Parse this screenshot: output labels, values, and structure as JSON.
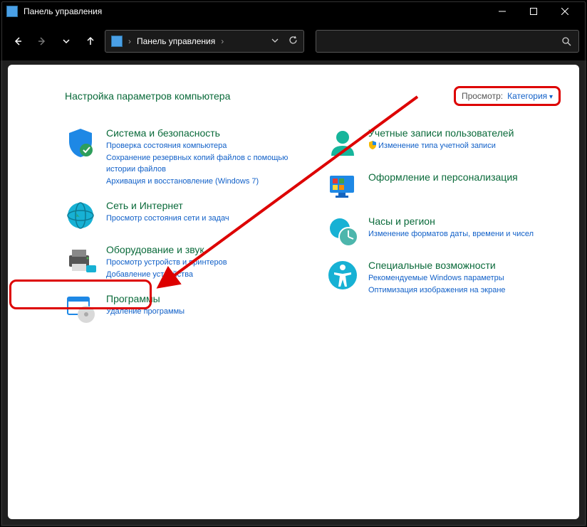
{
  "window": {
    "title": "Панель управления"
  },
  "address": {
    "root_label": "Панель управления"
  },
  "page": {
    "title": "Настройка параметров компьютера",
    "view_label": "Просмотр:",
    "view_value": "Категория"
  },
  "left": [
    {
      "title": "Система и безопасность",
      "links": [
        "Проверка состояния компьютера",
        "Сохранение резервных копий файлов с помощью истории файлов",
        "Архивация и восстановление (Windows 7)"
      ]
    },
    {
      "title": "Сеть и Интернет",
      "links": [
        "Просмотр состояния сети и задач"
      ]
    },
    {
      "title": "Оборудование и звук",
      "links": [
        "Просмотр устройств и принтеров",
        "Добавление устройства"
      ]
    },
    {
      "title": "Программы",
      "links": [
        "Удаление программы"
      ]
    }
  ],
  "right": [
    {
      "title": "Учетные записи пользователей",
      "links": [
        "Изменение типа учетной записи"
      ],
      "shielded": [
        0
      ]
    },
    {
      "title": "Оформление и персонализация",
      "links": []
    },
    {
      "title": "Часы и регион",
      "links": [
        "Изменение форматов даты, времени и чисел"
      ]
    },
    {
      "title": "Специальные возможности",
      "links": [
        "Рекомендуемые Windows параметры",
        "Оптимизация изображения на экране"
      ]
    }
  ]
}
